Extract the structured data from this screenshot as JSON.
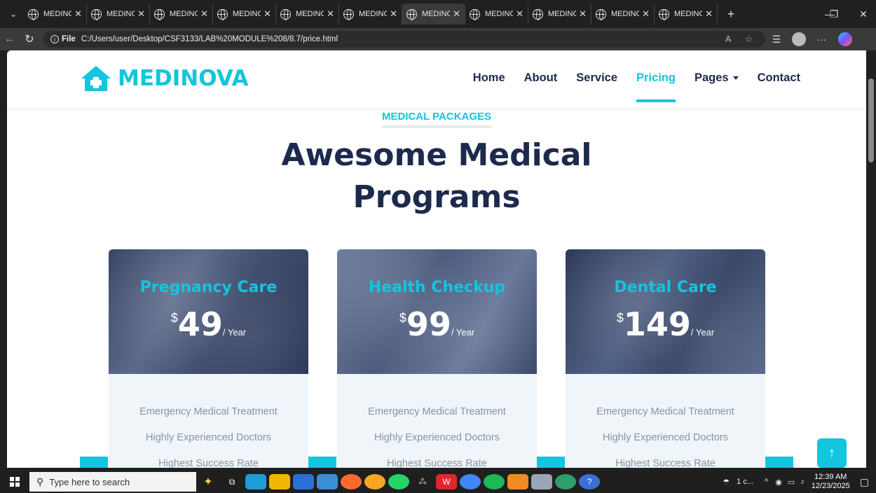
{
  "browser": {
    "tabs": [
      {
        "label": "MEDINOVA",
        "active": false
      },
      {
        "label": "MEDINOVA",
        "active": false
      },
      {
        "label": "MEDINOVA",
        "active": false
      },
      {
        "label": "MEDINOVA",
        "active": false
      },
      {
        "label": "MEDINOVA",
        "active": false
      },
      {
        "label": "MEDINOVA",
        "active": false
      },
      {
        "label": "MEDINOVA",
        "active": true
      },
      {
        "label": "MEDINOVA",
        "active": false
      },
      {
        "label": "MEDINOVA",
        "active": false
      },
      {
        "label": "MEDINOVA",
        "active": false
      },
      {
        "label": "MEDINOVA",
        "active": false
      }
    ],
    "address": {
      "scheme": "File",
      "url": "C:/Users/user/Desktop/CSF3133/LAB%20MODULE%208/8.7/price.html"
    }
  },
  "site": {
    "brand": "MEDINOVA",
    "nav": [
      {
        "label": "Home",
        "active": false,
        "dropdown": false
      },
      {
        "label": "About",
        "active": false,
        "dropdown": false
      },
      {
        "label": "Service",
        "active": false,
        "dropdown": false
      },
      {
        "label": "Pricing",
        "active": true,
        "dropdown": false
      },
      {
        "label": "Pages",
        "active": false,
        "dropdown": true
      },
      {
        "label": "Contact",
        "active": false,
        "dropdown": false
      }
    ],
    "eyebrow": "MEDICAL PACKAGES",
    "heading_line1": "Awesome Medical",
    "heading_line2": "Programs",
    "cards": [
      {
        "title": "Pregnancy Care",
        "currency": "$",
        "amount": "49",
        "period": "/ Year",
        "features": [
          "Emergency Medical Treatment",
          "Highly Experienced Doctors",
          "Highest Success Rate"
        ]
      },
      {
        "title": "Health Checkup",
        "currency": "$",
        "amount": "99",
        "period": "/ Year",
        "features": [
          "Emergency Medical Treatment",
          "Highly Experienced Doctors",
          "Highest Success Rate"
        ]
      },
      {
        "title": "Dental Care",
        "currency": "$",
        "amount": "149",
        "period": "/ Year",
        "features": [
          "Emergency Medical Treatment",
          "Highly Experienced Doctors",
          "Highest Success Rate"
        ]
      }
    ],
    "accent_color": "#13c5dd",
    "dark_color": "#1d2a4d"
  },
  "taskbar": {
    "search_placeholder": "Type here to search",
    "weather": "1 c...",
    "time": "12:39 AM",
    "date": "12/23/2025"
  }
}
